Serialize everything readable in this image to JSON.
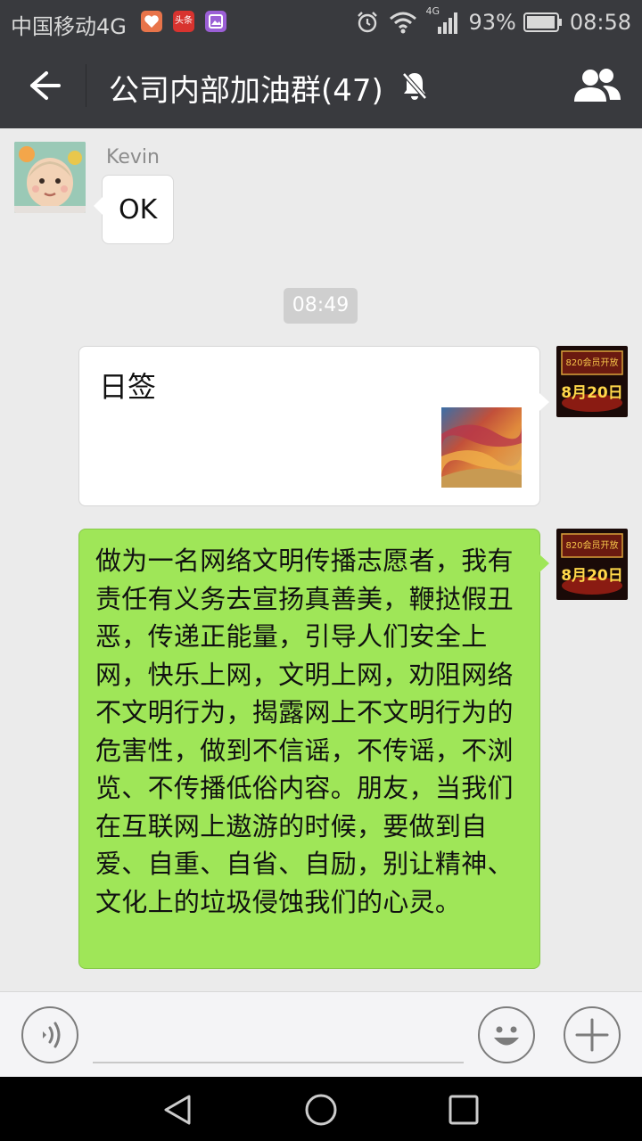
{
  "status_bar": {
    "carrier": "中国移动4G",
    "app_badges": [
      "heart-app-icon",
      "toutiao-icon",
      "gallery-icon"
    ],
    "toutiao_label": "头条",
    "network_label": "4G",
    "battery": "93%",
    "time": "08:58"
  },
  "header": {
    "title": "公司内部加油群(47)",
    "icons": [
      "back-arrow-icon",
      "mute-bell-icon",
      "group-members-icon"
    ]
  },
  "messages": {
    "m1": {
      "sender": "Kevin",
      "text": "OK"
    },
    "timestamp": "08:49",
    "m2": {
      "title": "日签"
    },
    "m3": {
      "text": "做为一名网络文明传播志愿者，我有责任有义务去宣扬真善美，鞭挞假丑恶，传递正能量，引导人们安全上网，快乐上网，文明上网，劝阻网络不文明行为，揭露网上不文明行为的危害性，做到不信谣，不传谣，不浏览、不传播低俗内容。朋友，当我们在互联网上遨游的时候，要做到自爱、自重、自省、自励，别让精神、文化上的垃圾侵蚀我们的心灵。"
    },
    "self_avatar_text": {
      "line1": "820会员开放",
      "line2": "8月20日"
    }
  },
  "input_bar": {
    "icons": [
      "voice-icon",
      "emoji-icon",
      "plus-icon"
    ],
    "placeholder": ""
  },
  "colors": {
    "titlebar": "#393a3e",
    "chat_background": "#ebebeb",
    "outgoing_bubble": "#9fe658"
  }
}
